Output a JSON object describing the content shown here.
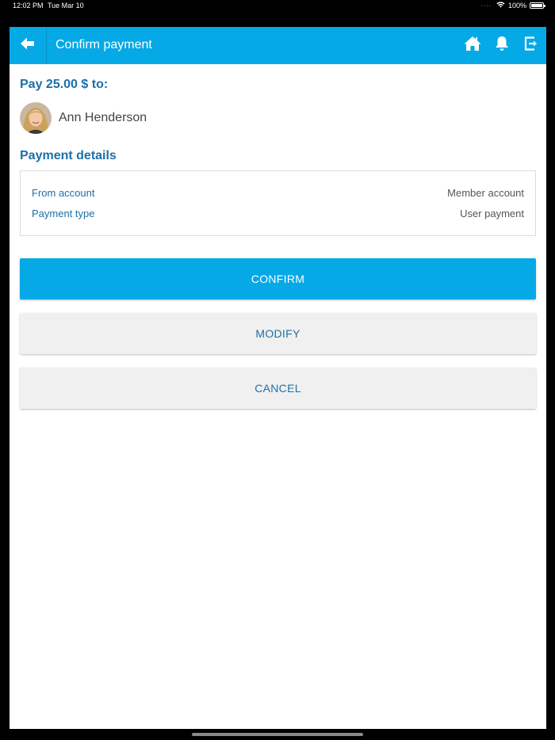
{
  "status_bar": {
    "time": "12:02 PM",
    "date": "Tue Mar 10",
    "battery": "100%",
    "wifi_icon": "wifi-icon",
    "battery_icon": "battery-icon"
  },
  "app_bar": {
    "title": "Confirm payment",
    "back_icon": "arrow-left-icon",
    "icons": [
      "home-icon",
      "bell-icon",
      "logout-icon"
    ],
    "background": "#04a9e6"
  },
  "payment": {
    "heading": "Pay 25.00 $ to:",
    "payee_name": "Ann Henderson"
  },
  "details": {
    "heading": "Payment details",
    "rows": [
      {
        "label": "From account",
        "value": "Member account"
      },
      {
        "label": "Payment type",
        "value": "User payment"
      }
    ]
  },
  "actions": {
    "confirm": "CONFIRM",
    "modify": "MODIFY",
    "cancel": "CANCEL"
  },
  "colors": {
    "accent": "#04a9e6",
    "heading_text": "#1d6fa8",
    "secondary_button": "#f0f0f0"
  }
}
